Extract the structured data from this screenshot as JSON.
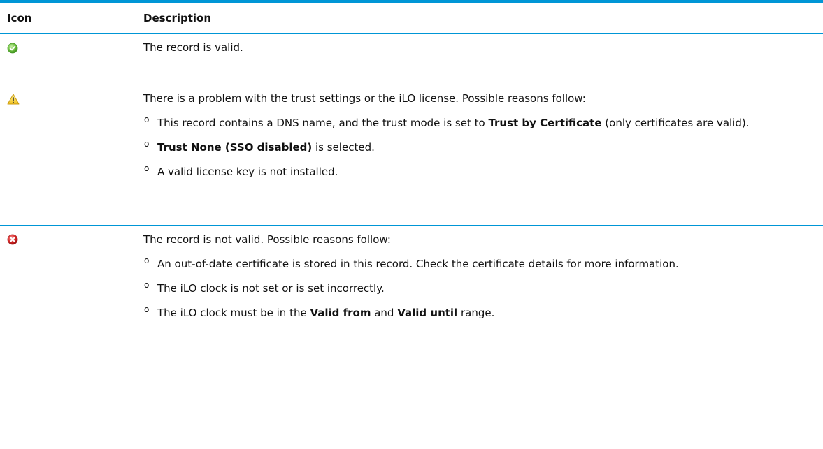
{
  "table": {
    "headers": {
      "icon": "Icon",
      "description": "Description"
    },
    "rows": [
      {
        "icon": "check-circle-icon",
        "lead": "The record is valid."
      },
      {
        "icon": "warning-triangle-icon",
        "lead": "There is a problem with the trust settings or the iLO license. Possible reasons follow:",
        "bullets": [
          {
            "before": "This record contains a DNS name, and the trust mode is set to ",
            "bold": "Trust by Certificate",
            "after": " (only certificates are valid)."
          },
          {
            "bold": "Trust None (SSO disabled)",
            "after": " is selected."
          },
          {
            "text": "A valid license key is not installed."
          }
        ]
      },
      {
        "icon": "error-x-circle-icon",
        "lead": "The record is not valid. Possible reasons follow:",
        "bullets": [
          {
            "text": "An out-of-date certificate is stored in this record. Check the certificate details for more information."
          },
          {
            "text": "The iLO clock is not set or is set incorrectly."
          },
          {
            "before": "The iLO clock must be in the ",
            "bold1": "Valid from",
            "middle": " and ",
            "bold2": "Valid until",
            "after": " range."
          }
        ]
      }
    ],
    "bullet_symbol": "o"
  },
  "colors": {
    "border": "#0096d6",
    "valid_green": "#6cbf3e",
    "warning_yellow": "#f6d531",
    "error_red": "#d82a2a"
  }
}
